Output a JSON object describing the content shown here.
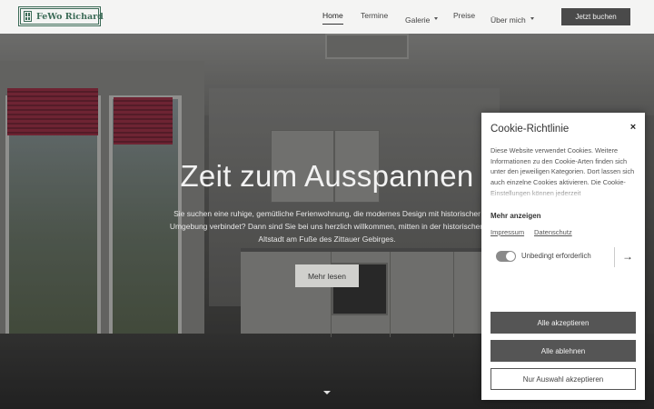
{
  "header": {
    "logo_text": "FeWo Richard",
    "nav": [
      {
        "label": "Home",
        "active": true,
        "dropdown": false
      },
      {
        "label": "Termine",
        "active": false,
        "dropdown": false
      },
      {
        "label": "Galerie",
        "active": false,
        "dropdown": true
      },
      {
        "label": "Preise",
        "active": false,
        "dropdown": false
      },
      {
        "label": "Über mich",
        "active": false,
        "dropdown": true
      }
    ],
    "book_button": "Jetzt buchen"
  },
  "hero": {
    "title": "Zeit zum Ausspannen",
    "text": "Sie suchen eine ruhige, gemütliche Ferienwohnung, die modernes Design mit historischer Umgebung verbindet? Dann sind Sie bei uns herzlich willkommen, mitten in der historischen Altstadt am Fuße des Zittauer Gebirges.",
    "button": "Mehr lesen",
    "accent_color": "#d0d0cd"
  },
  "cookie": {
    "title": "Cookie-Richtlinie",
    "close_label": "×",
    "text": "Diese Website verwendet Cookies. Weitere Informationen zu den Cookie-Arten finden sich unter den jeweiligen Kategorien. Dort lassen sich auch einzelne Cookies aktivieren. Die Cookie-Einstellungen können jederzeit",
    "show_more": "Mehr anzeigen",
    "links": [
      "Impressum",
      "Datenschutz"
    ],
    "toggle_label": "Unbedingt erforderlich",
    "toggle_on": true,
    "arrow": "→",
    "buttons": {
      "accept_all": "Alle akzeptieren",
      "reject_all": "Alle ablehnen",
      "accept_selection": "Nur Auswahl akzeptieren"
    },
    "button_color": "#555555"
  },
  "brand_color": "#3c6b57"
}
